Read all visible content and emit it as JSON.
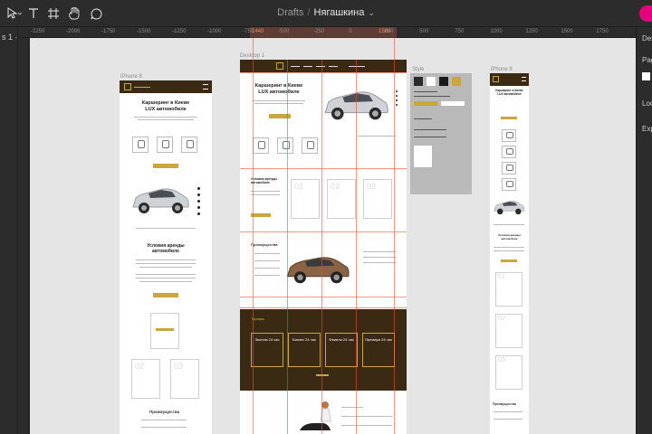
{
  "toolbar": {
    "breadcrumb_parent": "Drafts",
    "separator": "/",
    "file_name": "Нягашкина",
    "tools": [
      "move-tool",
      "frame-tool",
      "text-tool",
      "component-tool",
      "hand-tool",
      "comment-tool"
    ]
  },
  "left_panel": {
    "partial_label": "s 1 ·"
  },
  "right_panel": {
    "partial_labels": [
      "Des",
      "Pag",
      "Loc",
      "Exp"
    ]
  },
  "ruler": {
    "ticks": [
      "-2250",
      "-2000",
      "-1750",
      "-1500",
      "-1250",
      "-1000",
      "-750",
      "-500",
      "-250",
      "0",
      "250",
      "500",
      "750",
      "1000",
      "1250",
      "1500",
      "1750"
    ],
    "highlight_ticks": [
      "1440",
      "1560"
    ]
  },
  "canvas": {
    "frames": [
      {
        "label": "iPhone 8"
      },
      {
        "label": "Desktop 1"
      },
      {
        "label": "Style"
      },
      {
        "label": "iPhone 8"
      }
    ],
    "mobile": {
      "hero_title": "Каршеринг в Киеве\nLUX автомобиле",
      "rent_title": "Условия аренды\nавтомобиле",
      "advantages": "Преимущества",
      "cards": [
        "01",
        "02",
        "03"
      ]
    },
    "desktop": {
      "hero_title": "Каршеринг в Киеве\nLUX автомобиле",
      "rent_title": "Условия аренды\nавтомобиле",
      "advantages": "Преимущества",
      "cards": [
        "01",
        "02",
        "03"
      ],
      "price_section_label": "Тарифы",
      "prices": [
        "Эконом 24 час",
        "Бизнес 24 час",
        "Фэмили 24 час",
        "Премиум 24 час"
      ]
    },
    "style_frame": {
      "colors": [
        "#2b2b2b",
        "#ffffff",
        "#1a1a1a",
        "#c9a640"
      ]
    },
    "mobile_right": {
      "hero_title": "Каршеринг в Киеве\nLUX автомобиле",
      "rent_title": "Условия аренды\nавтомобиле",
      "advantages": "Преимущества",
      "cards": [
        "01",
        "02",
        "03"
      ]
    }
  },
  "colors": {
    "accent_gold": "#c9a640",
    "nav_brown": "#3a2a14",
    "canvas_bg": "#e5e5e5",
    "app_chrome": "#2c2c2c",
    "guide_red": "#e6503c"
  }
}
